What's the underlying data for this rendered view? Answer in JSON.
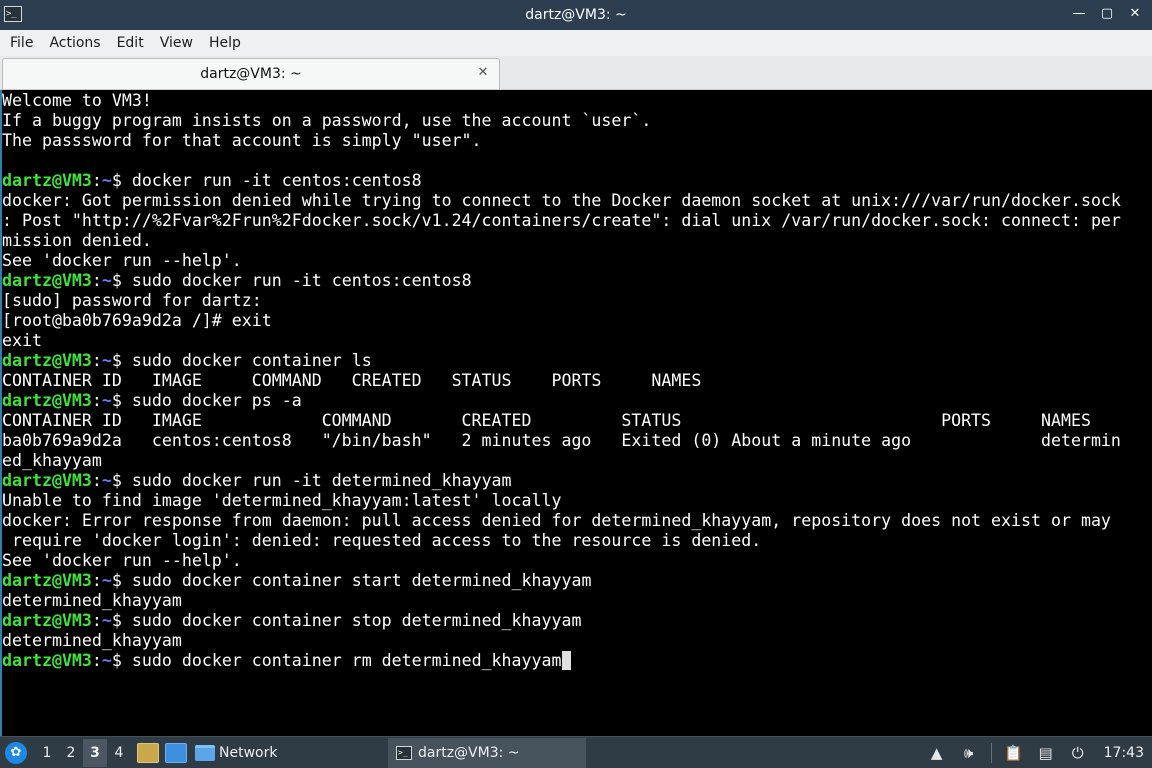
{
  "window": {
    "title": "dartz@VM3: ~",
    "icon": "terminal-icon",
    "controls": [
      "minimize",
      "maximize",
      "close"
    ]
  },
  "menu": [
    "File",
    "Actions",
    "Edit",
    "View",
    "Help"
  ],
  "tab": {
    "label": "dartz@VM3: ~",
    "close_icon": "close-icon"
  },
  "terminal": {
    "colors": {
      "user": "#3ee33a",
      "path": "#5c7dff",
      "text": "#ffffff",
      "background": "#000000"
    },
    "prompt_user": "dartz@VM3",
    "prompt_path": "~",
    "prompt_symbol": "$",
    "lines": [
      {
        "type": "text",
        "text": "Welcome to VM3!"
      },
      {
        "type": "text",
        "text": "If a buggy program insists on a password, use the account `user`."
      },
      {
        "type": "text",
        "text": "The passsword for that account is simply \"user\"."
      },
      {
        "type": "text",
        "text": ""
      },
      {
        "type": "cmd",
        "text": " docker run -it centos:centos8"
      },
      {
        "type": "text",
        "text": "docker: Got permission denied while trying to connect to the Docker daemon socket at unix:///var/run/docker.sock"
      },
      {
        "type": "text",
        "text": ": Post \"http://%2Fvar%2Frun%2Fdocker.sock/v1.24/containers/create\": dial unix /var/run/docker.sock: connect: per"
      },
      {
        "type": "text",
        "text": "mission denied."
      },
      {
        "type": "text",
        "text": "See 'docker run --help'."
      },
      {
        "type": "cmd",
        "text": " sudo docker run -it centos:centos8"
      },
      {
        "type": "text",
        "text": "[sudo] password for dartz:"
      },
      {
        "type": "text",
        "text": "[root@ba0b769a9d2a /]# exit"
      },
      {
        "type": "text",
        "text": "exit"
      },
      {
        "type": "cmd",
        "text": " sudo docker container ls"
      },
      {
        "type": "text",
        "text": "CONTAINER ID   IMAGE     COMMAND   CREATED   STATUS    PORTS     NAMES"
      },
      {
        "type": "cmd",
        "text": " sudo docker ps -a"
      },
      {
        "type": "text",
        "text": "CONTAINER ID   IMAGE            COMMAND       CREATED         STATUS                          PORTS     NAMES"
      },
      {
        "type": "text",
        "text": "ba0b769a9d2a   centos:centos8   \"/bin/bash\"   2 minutes ago   Exited (0) About a minute ago             determin"
      },
      {
        "type": "text",
        "text": "ed_khayyam"
      },
      {
        "type": "cmd",
        "text": " sudo docker run -it determined_khayyam"
      },
      {
        "type": "text",
        "text": "Unable to find image 'determined_khayyam:latest' locally"
      },
      {
        "type": "text",
        "text": "docker: Error response from daemon: pull access denied for determined_khayyam, repository does not exist or may"
      },
      {
        "type": "text",
        "text": " require 'docker login': denied: requested access to the resource is denied."
      },
      {
        "type": "text",
        "text": "See 'docker run --help'."
      },
      {
        "type": "cmd",
        "text": " sudo docker container start determined_khayyam"
      },
      {
        "type": "text",
        "text": "determined_khayyam"
      },
      {
        "type": "cmd",
        "text": " sudo docker container stop determined_khayyam"
      },
      {
        "type": "text",
        "text": "determined_khayyam"
      },
      {
        "type": "cmd",
        "text": " sudo docker container rm determined_khayyam",
        "cursor": true
      }
    ]
  },
  "taskbar": {
    "workspaces": [
      "1",
      "2",
      "3",
      "4"
    ],
    "active_workspace": "3",
    "launcher_label": "Network",
    "task_label": "dartz@VM3: ~",
    "clock": "17:43",
    "tray_icons": [
      "update-icon",
      "volume-icon",
      "clipboard-icon",
      "network-icon",
      "power-icon"
    ]
  }
}
